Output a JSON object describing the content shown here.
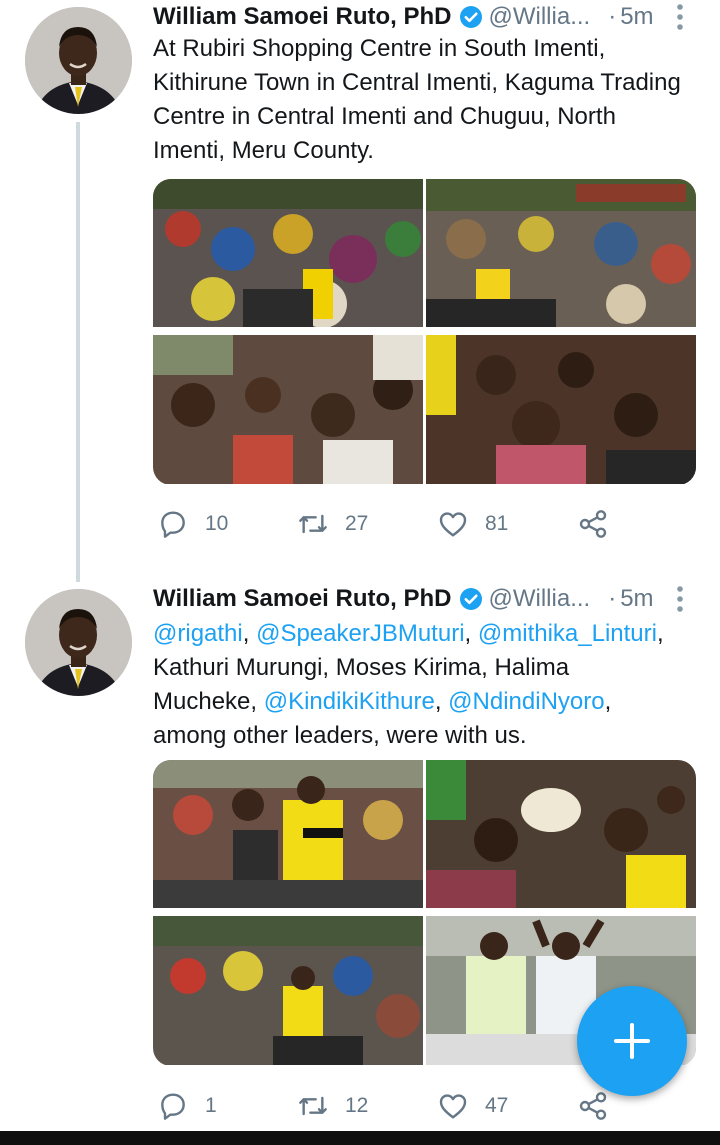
{
  "colors": {
    "accent": "#1da1f2",
    "muted": "#657786",
    "text": "#14171a",
    "thread_line": "#cfd9de"
  },
  "tweets": [
    {
      "name": "William Samoei Ruto, PhD",
      "handle": "@Willia...",
      "separator": "·",
      "time": "5m",
      "text_plain": "At Rubiri Shopping Centre in South Imenti, Kithirune Town in Central Imenti, Kaguma Trading Centre in Central Imenti and Chuguu, North Imenti, Meru County.",
      "replies": "10",
      "retweets": "27",
      "likes": "81"
    },
    {
      "name": "William Samoei Ruto, PhD",
      "handle": "@Willia...",
      "separator": "·",
      "time": "5m",
      "mentions": [
        "@rigathi",
        "@SpeakerJBMuturi",
        "@mithika_Linturi",
        "@KindikiKithure",
        "@NdindiNyoro"
      ],
      "text_parts": [
        ", ",
        ", ",
        ",\nKathuri Murungi, Moses Kirima, Halima\nMucheke, ",
        ", ",
        ",\namong other leaders, were with us."
      ],
      "replies": "1",
      "retweets": "12",
      "likes": "47"
    }
  ],
  "icons": {
    "verified": "verified-badge-icon",
    "more": "more-vertical-icon",
    "reply": "reply-icon",
    "retweet": "retweet-icon",
    "like": "heart-icon",
    "share": "share-icon",
    "compose": "plus-icon"
  }
}
